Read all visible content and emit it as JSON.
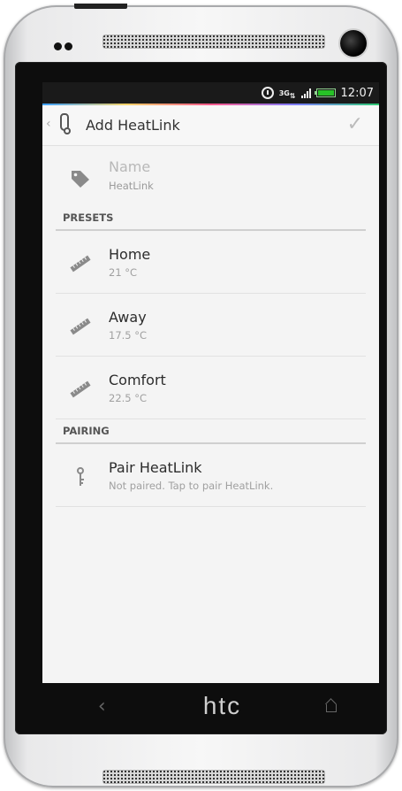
{
  "status_bar": {
    "time": "12:07",
    "network_label": "3G",
    "icons": [
      "alarm-icon",
      "network-3g-icon",
      "signal-icon",
      "battery-icon"
    ]
  },
  "action_bar": {
    "title": "Add HeatLink",
    "icons": [
      "back-chevron-icon",
      "thermometer-icon",
      "checkmark-icon"
    ]
  },
  "name_row": {
    "label": "Name",
    "value": "HeatLink",
    "icon": "tag-icon"
  },
  "presets": {
    "header": "PRESETS",
    "items": [
      {
        "title": "Home",
        "value": "21 °C",
        "icon": "ruler-icon"
      },
      {
        "title": "Away",
        "value": "17.5 °C",
        "icon": "ruler-icon"
      },
      {
        "title": "Comfort",
        "value": "22.5 °C",
        "icon": "ruler-icon"
      }
    ]
  },
  "pairing": {
    "header": "PAIRING",
    "item": {
      "title": "Pair HeatLink",
      "subtitle": "Not paired. Tap to pair HeatLink.",
      "icon": "key-icon"
    }
  },
  "nav_bar": {
    "brand": "htc",
    "icons": [
      "nav-back-icon",
      "nav-home-icon"
    ]
  },
  "colors": {
    "screen_bg": "#f4f4f4",
    "divider": "#e1e1e1",
    "icon_gray": "#8a8a8a",
    "battery_green": "#27c227"
  }
}
